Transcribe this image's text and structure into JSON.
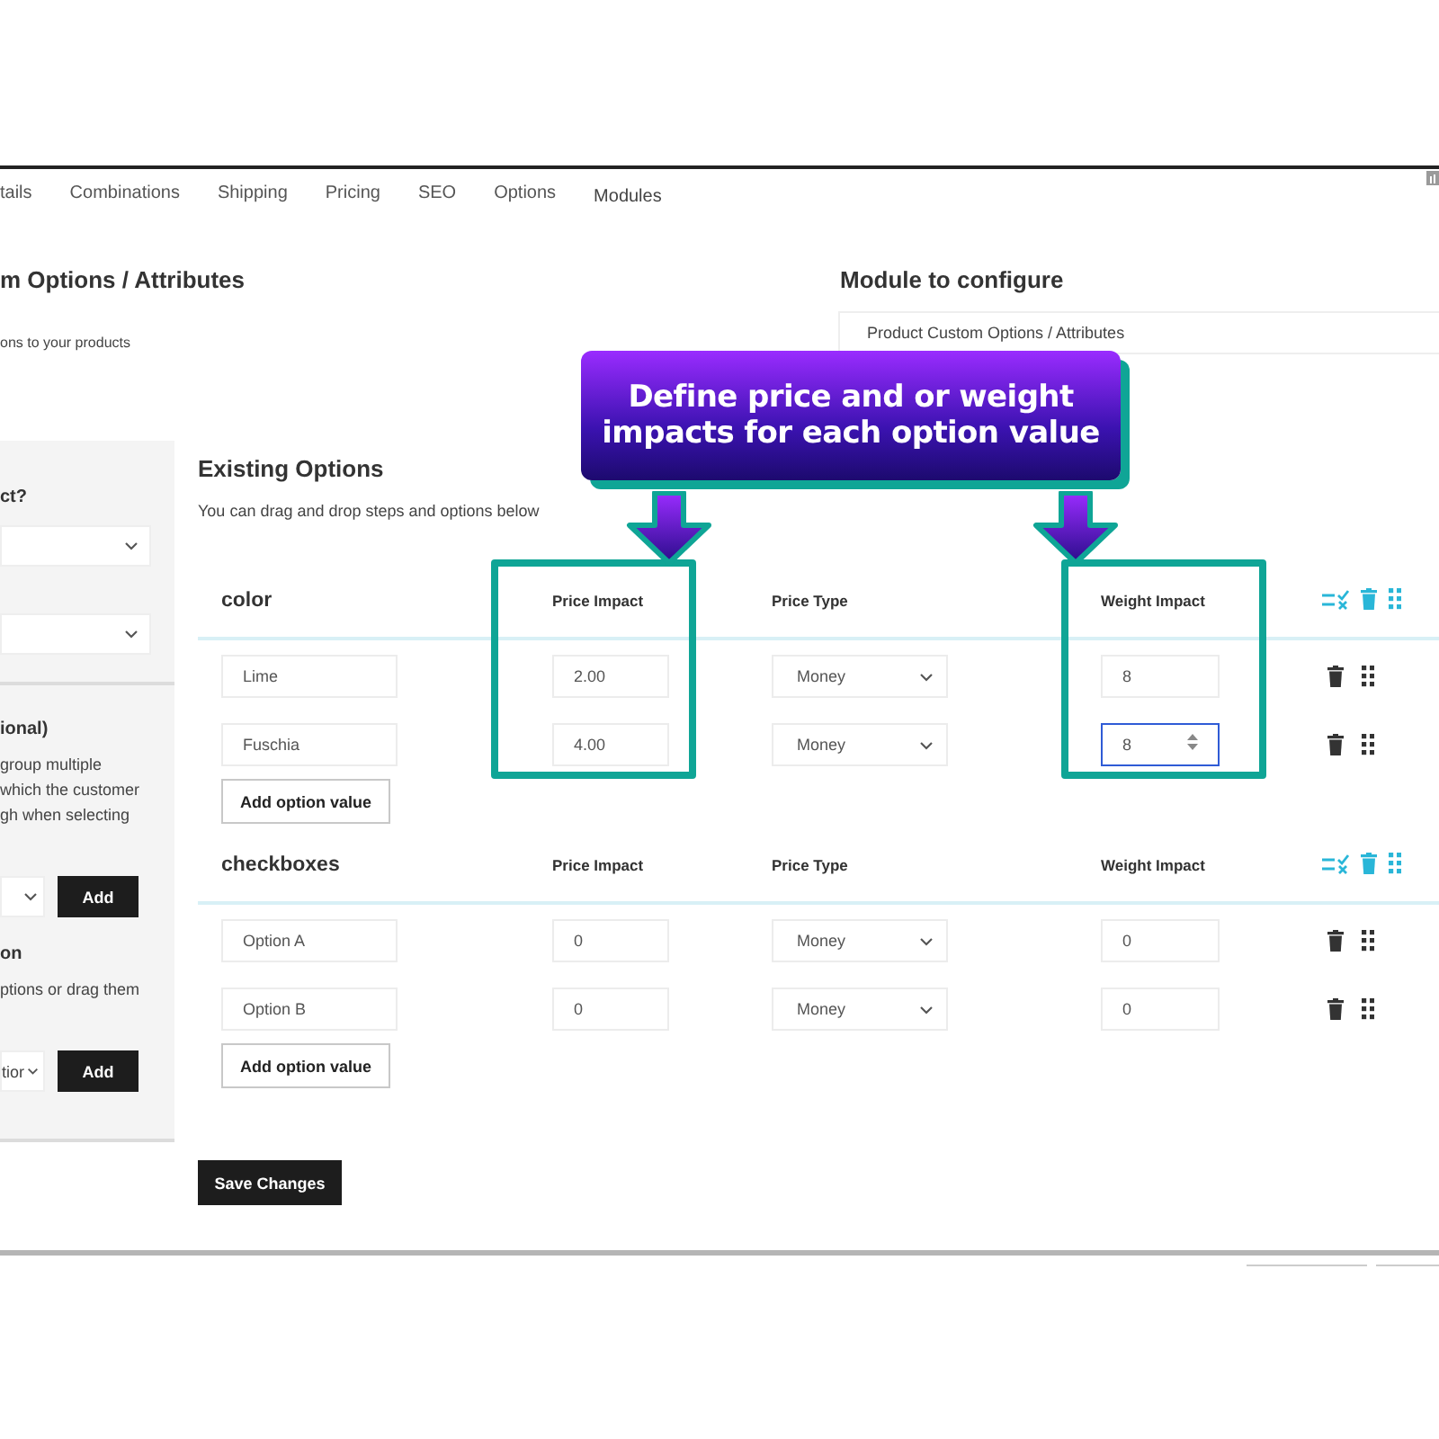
{
  "tabs": [
    {
      "label": "tails",
      "selected": false
    },
    {
      "label": "Combinations",
      "selected": false
    },
    {
      "label": "Shipping",
      "selected": false
    },
    {
      "label": "Pricing",
      "selected": false
    },
    {
      "label": "SEO",
      "selected": false
    },
    {
      "label": "Options",
      "selected": false
    },
    {
      "label": "Modules",
      "selected": true
    }
  ],
  "header": {
    "title": "m Options / Attributes",
    "description": "ons to your products"
  },
  "module": {
    "label": "Module to configure",
    "value": "Product Custom Options / Attributes"
  },
  "sidebar": {
    "blocks": [
      {
        "kind": "heading",
        "text": "ct?"
      },
      {
        "kind": "select"
      },
      {
        "kind": "select"
      },
      {
        "kind": "divider"
      },
      {
        "kind": "heading",
        "text": "ional)"
      },
      {
        "kind": "text",
        "text": "group multiple\nwhich the customer\ngh when selecting"
      },
      {
        "kind": "add_row",
        "button": "Add"
      },
      {
        "kind": "heading",
        "text": "on"
      },
      {
        "kind": "text",
        "text": "ptions or drag them"
      },
      {
        "kind": "add_row",
        "value": "tior",
        "button": "Add"
      }
    ]
  },
  "existing": {
    "title": "Existing Options",
    "description": "You can drag and drop steps and options below"
  },
  "groups": [
    {
      "name": "color",
      "columns": [
        "Price Impact",
        "Price Type",
        "Weight Impact"
      ],
      "values": [
        {
          "name": "Lime",
          "price_impact": "2.00",
          "price_type": "Money",
          "weight_impact": "8",
          "focused": false
        },
        {
          "name": "Fuschia",
          "price_impact": "4.00",
          "price_type": "Money",
          "weight_impact": "8",
          "focused": true
        }
      ],
      "add_button": "Add option value"
    },
    {
      "name": "checkboxes",
      "columns": [
        "Price Impact",
        "Price Type",
        "Weight Impact"
      ],
      "values": [
        {
          "name": "Option A",
          "price_impact": "0",
          "price_type": "Money",
          "weight_impact": "0",
          "focused": false
        },
        {
          "name": "Option B",
          "price_impact": "0",
          "price_type": "Money",
          "weight_impact": "0",
          "focused": false
        }
      ],
      "add_button": "Add option value"
    }
  ],
  "save_button": "Save Changes",
  "callout": {
    "lines": [
      "Define price and or weight",
      "impacts for each option value"
    ]
  }
}
